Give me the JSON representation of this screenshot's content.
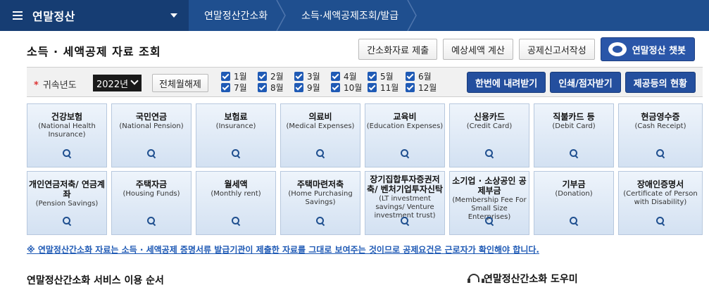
{
  "topnav": {
    "menu_title": "연말정산",
    "breadcrumbs": [
      "연말정산간소화",
      "소득·세액공제조회/발급"
    ]
  },
  "page_title": "소득 · 세액공제 자료 조회",
  "header_buttons": {
    "submit": "간소화자료 제출",
    "estimate": "예상세액 계산",
    "deduction_form": "공제신고서작성",
    "chatbot": "연말정산 챗봇"
  },
  "filter": {
    "label": "귀속년도",
    "year_selected": "2022년",
    "clear_all": "전체월해제",
    "months": [
      "1월",
      "2월",
      "3월",
      "4월",
      "5월",
      "6월",
      "7월",
      "8월",
      "9월",
      "10월",
      "11월",
      "12월"
    ],
    "actions": {
      "download_all": "한번에 내려받기",
      "print": "인쇄/점자받기",
      "provider_status": "제공등의 현황"
    }
  },
  "tiles": [
    {
      "kr": "건강보험",
      "en": "(National Health Insurance)"
    },
    {
      "kr": "국민연금",
      "en": "(National Pension)"
    },
    {
      "kr": "보험료",
      "en": "(Insurance)"
    },
    {
      "kr": "의료비",
      "en": "(Medical Expenses)"
    },
    {
      "kr": "교육비",
      "en": "(Education Expenses)"
    },
    {
      "kr": "신용카드",
      "en": "(Credit Card)"
    },
    {
      "kr": "직불카드 등",
      "en": "(Debit Card)"
    },
    {
      "kr": "현금영수증",
      "en": "(Cash Receipt)"
    },
    {
      "kr": "개인연금저축/ 연금계좌",
      "en": "(Pension Savings)"
    },
    {
      "kr": "주택자금",
      "en": "(Housing Funds)"
    },
    {
      "kr": "월세액",
      "en": "(Monthly rent)"
    },
    {
      "kr": "주택마련저축",
      "en": "(Home Purchasing Savings)"
    },
    {
      "kr": "장기집합투자증권저축/ 벤처기업투자신탁",
      "en": "(LT investment savings/ Venture investment trust)"
    },
    {
      "kr": "소기업 · 소상공인 공제부금",
      "en": "(Membership Fee For Small Size Enterprises)"
    },
    {
      "kr": "기부금",
      "en": "(Donation)"
    },
    {
      "kr": "장애인증명서",
      "en": "(Certificate of Person with Disability)"
    }
  ],
  "notice": "※ 연말정산간소화 자료는 소득 · 세액공제 증명서류 발급기관이 제출한 자료를 그대로 보여주는 것이므로 공제요건은 근로자가 확인해야 합니다.",
  "sections": {
    "service_order": "연말정산간소화 서비스 이용 순서",
    "helper": "연말정산간소화 도우미"
  }
}
